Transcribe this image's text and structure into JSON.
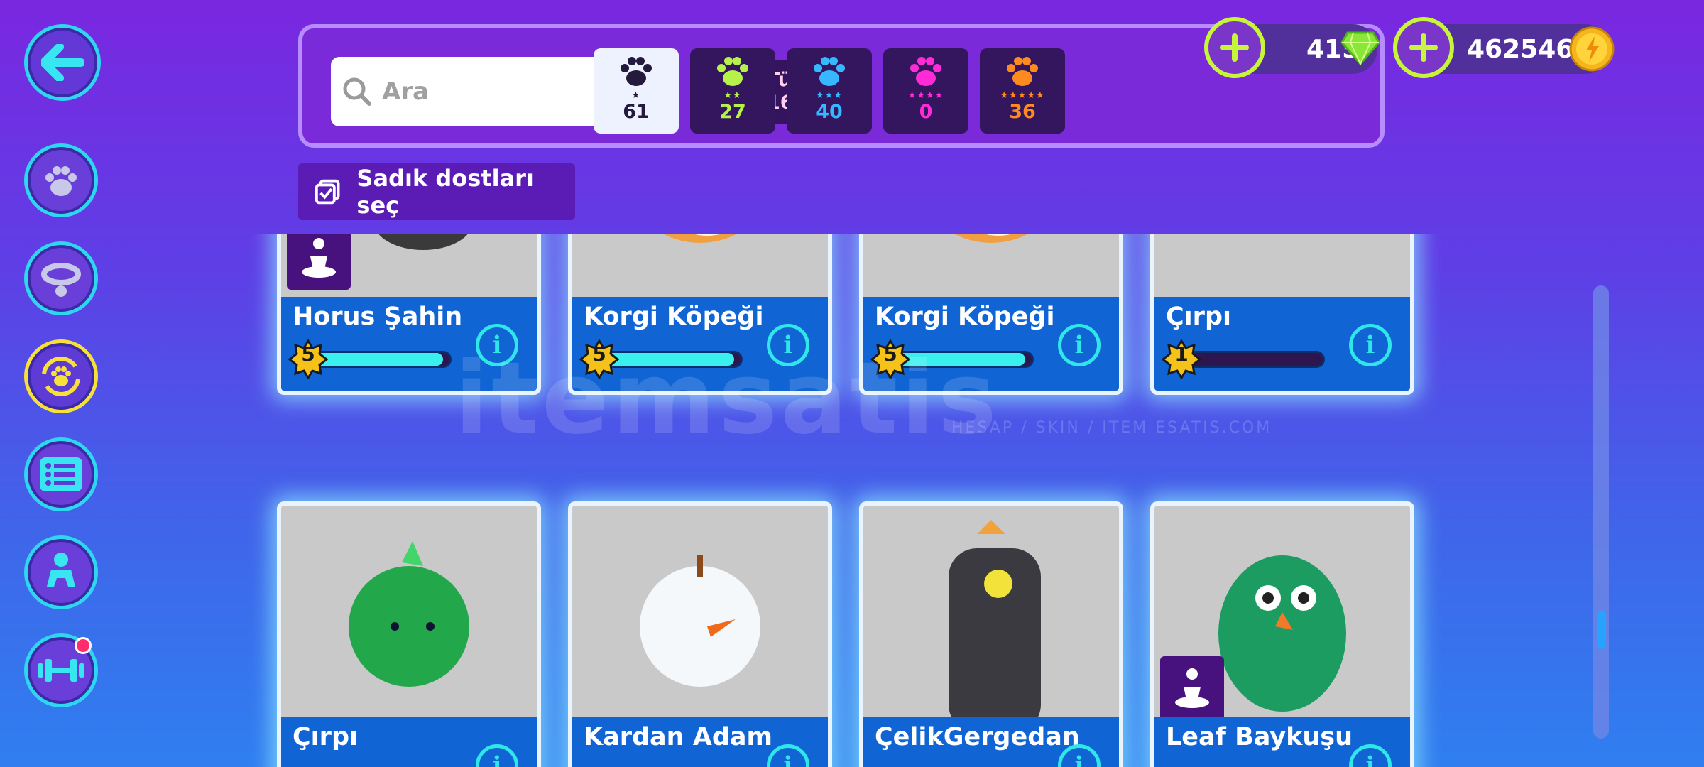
{
  "colors": {
    "accent_cyan": "#2fd6f0",
    "accent_lime": "#c7f53a",
    "card_footer": "#1064d4"
  },
  "search": {
    "placeholder": "Ara"
  },
  "filter_all": {
    "label": "Tümü",
    "count": "164/350"
  },
  "rarity_filters": [
    {
      "stars": "★",
      "count": "61",
      "color": "#241a3d",
      "selected": true
    },
    {
      "stars": "★★",
      "count": "27",
      "color": "#b6f24a"
    },
    {
      "stars": "★★★",
      "count": "40",
      "color": "#35b8ff"
    },
    {
      "stars": "★★★★",
      "count": "0",
      "color": "#ff2bd6"
    },
    {
      "stars": "★★★★★",
      "count": "36",
      "color": "#ff8a1e"
    }
  ],
  "currency": {
    "gems": "415",
    "coins": "462546"
  },
  "loyal_button": {
    "label": "Sadık dostları seç"
  },
  "pets": [
    {
      "name": "Horus Şahin",
      "level": "5",
      "progress": 0.95,
      "badge": true
    },
    {
      "name": "Korgi Köpeği",
      "level": "5",
      "progress": 0.95
    },
    {
      "name": "Korgi Köpeği",
      "level": "5",
      "progress": 0.95
    },
    {
      "name": "Çırpı",
      "level": "1",
      "progress": 0
    },
    {
      "name": "Çırpı",
      "level": "",
      "progress": 0
    },
    {
      "name": "Kardan Adam",
      "level": "",
      "progress": 0
    },
    {
      "name": "ÇelikGergedan",
      "level": "",
      "progress": 0
    },
    {
      "name": "Leaf Baykuşu",
      "level": "",
      "progress": 0,
      "badge": true
    }
  ],
  "watermark": {
    "text": "itemsatis",
    "sub": "HESAP / SKIN / ITEM ESATIS.COM"
  }
}
